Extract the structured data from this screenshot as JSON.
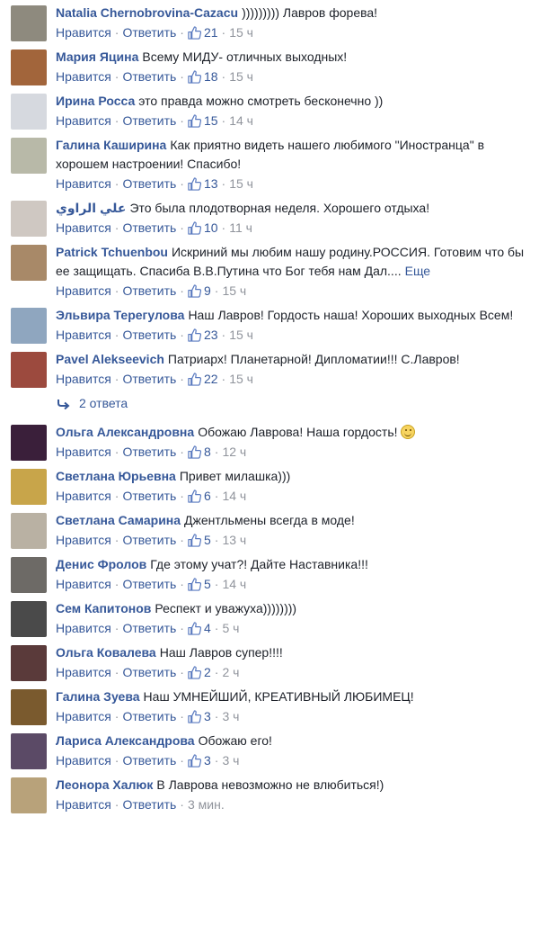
{
  "actions": {
    "like": "Нравится",
    "reply": "Ответить",
    "sep": "·"
  },
  "comments": [
    {
      "author": "Natalia Chernobrovina-Cazacu",
      "text": "))))))))) Лавров форева!",
      "likes": "21",
      "time": "15 ч",
      "avatar": "#8e8a7e"
    },
    {
      "author": "Мария Яцина",
      "text": "Всему МИДУ- отличных выходных!",
      "likes": "18",
      "time": "15 ч",
      "avatar": "#a2653b"
    },
    {
      "author": "Ирина Росса",
      "text": "это правда можно смотреть бесконечно ))",
      "likes": "15",
      "time": "14 ч",
      "avatar": "#d6d9df"
    },
    {
      "author": "Галина Каширина",
      "text": "Как приятно видеть нашего любимого \"Иностранца\" в хорошем настроении! Спасибо!",
      "likes": "13",
      "time": "15 ч",
      "avatar": "#b8b9a8"
    },
    {
      "author": "علي الراوي",
      "text": "Это была плодотворная неделя. Хорошего отдыха!",
      "likes": "10",
      "time": "11 ч",
      "avatar": "#cfc8c2"
    },
    {
      "author": "Patrick Tchuenbou",
      "text": "Искриний мы любим нашу родину.РОССИЯ. Готовим что бы ее защищать. Спасиба В.В.Путина что Бог тебя нам Дал....",
      "more": "Еще",
      "likes": "9",
      "time": "15 ч",
      "avatar": "#a88968"
    },
    {
      "author": "Эльвира Терегулова",
      "text": "Наш Лавров! Гордость наша! Хороших выходных Всем!",
      "likes": "23",
      "time": "15 ч",
      "avatar": "#8fa6bf"
    },
    {
      "author": "Pavel Alekseevich",
      "text": "Патриарх! Планетарной! Дипломатии!!! С.Лавров!",
      "likes": "22",
      "time": "15 ч",
      "avatar": "#9c4a3e"
    }
  ],
  "replies_link": "2 ответа",
  "comments2": [
    {
      "author": "Ольга Александровна",
      "text": "Обожаю Лаврова! Наша гордость!",
      "emoji": "smile-emoji",
      "likes": "8",
      "time": "12 ч",
      "avatar": "#3a1f3a"
    },
    {
      "author": "Светлана Юрьевна",
      "text": "Привет милашка)))",
      "likes": "6",
      "time": "14 ч",
      "avatar": "#c8a54a"
    },
    {
      "author": "Светлана Самарина",
      "text": "Джентльмены всегда в моде!",
      "likes": "5",
      "time": "13 ч",
      "avatar": "#b9b1a3"
    },
    {
      "author": "Денис Фролов",
      "text": "Где этому учат?! Дайте Наставника!!!",
      "likes": "5",
      "time": "14 ч",
      "avatar": "#6d6a66"
    },
    {
      "author": "Сем Капитонов",
      "text": "Респект и уважуха))))))))",
      "likes": "4",
      "time": "5 ч",
      "avatar": "#4a4a4a"
    },
    {
      "author": "Ольга Ковалева",
      "text": "Наш Лавров супер!!!!",
      "likes": "2",
      "time": "2 ч",
      "avatar": "#5a3a3a"
    },
    {
      "author": "Галина Зуева",
      "text": "Наш УМНЕЙШИЙ, КРЕАТИВНЫЙ ЛЮБИМЕЦ!",
      "likes": "3",
      "time": "3 ч",
      "avatar": "#7a5a2e"
    },
    {
      "author": "Лариса Александрова",
      "text": "Обожаю его!",
      "likes": "3",
      "time": "3 ч",
      "avatar": "#5b4a66"
    },
    {
      "author": "Леонора Халюк",
      "text": "В Лаврова невозможно не влюбиться!)",
      "likes": "",
      "time": "3 мин.",
      "avatar": "#b8a27a"
    }
  ]
}
